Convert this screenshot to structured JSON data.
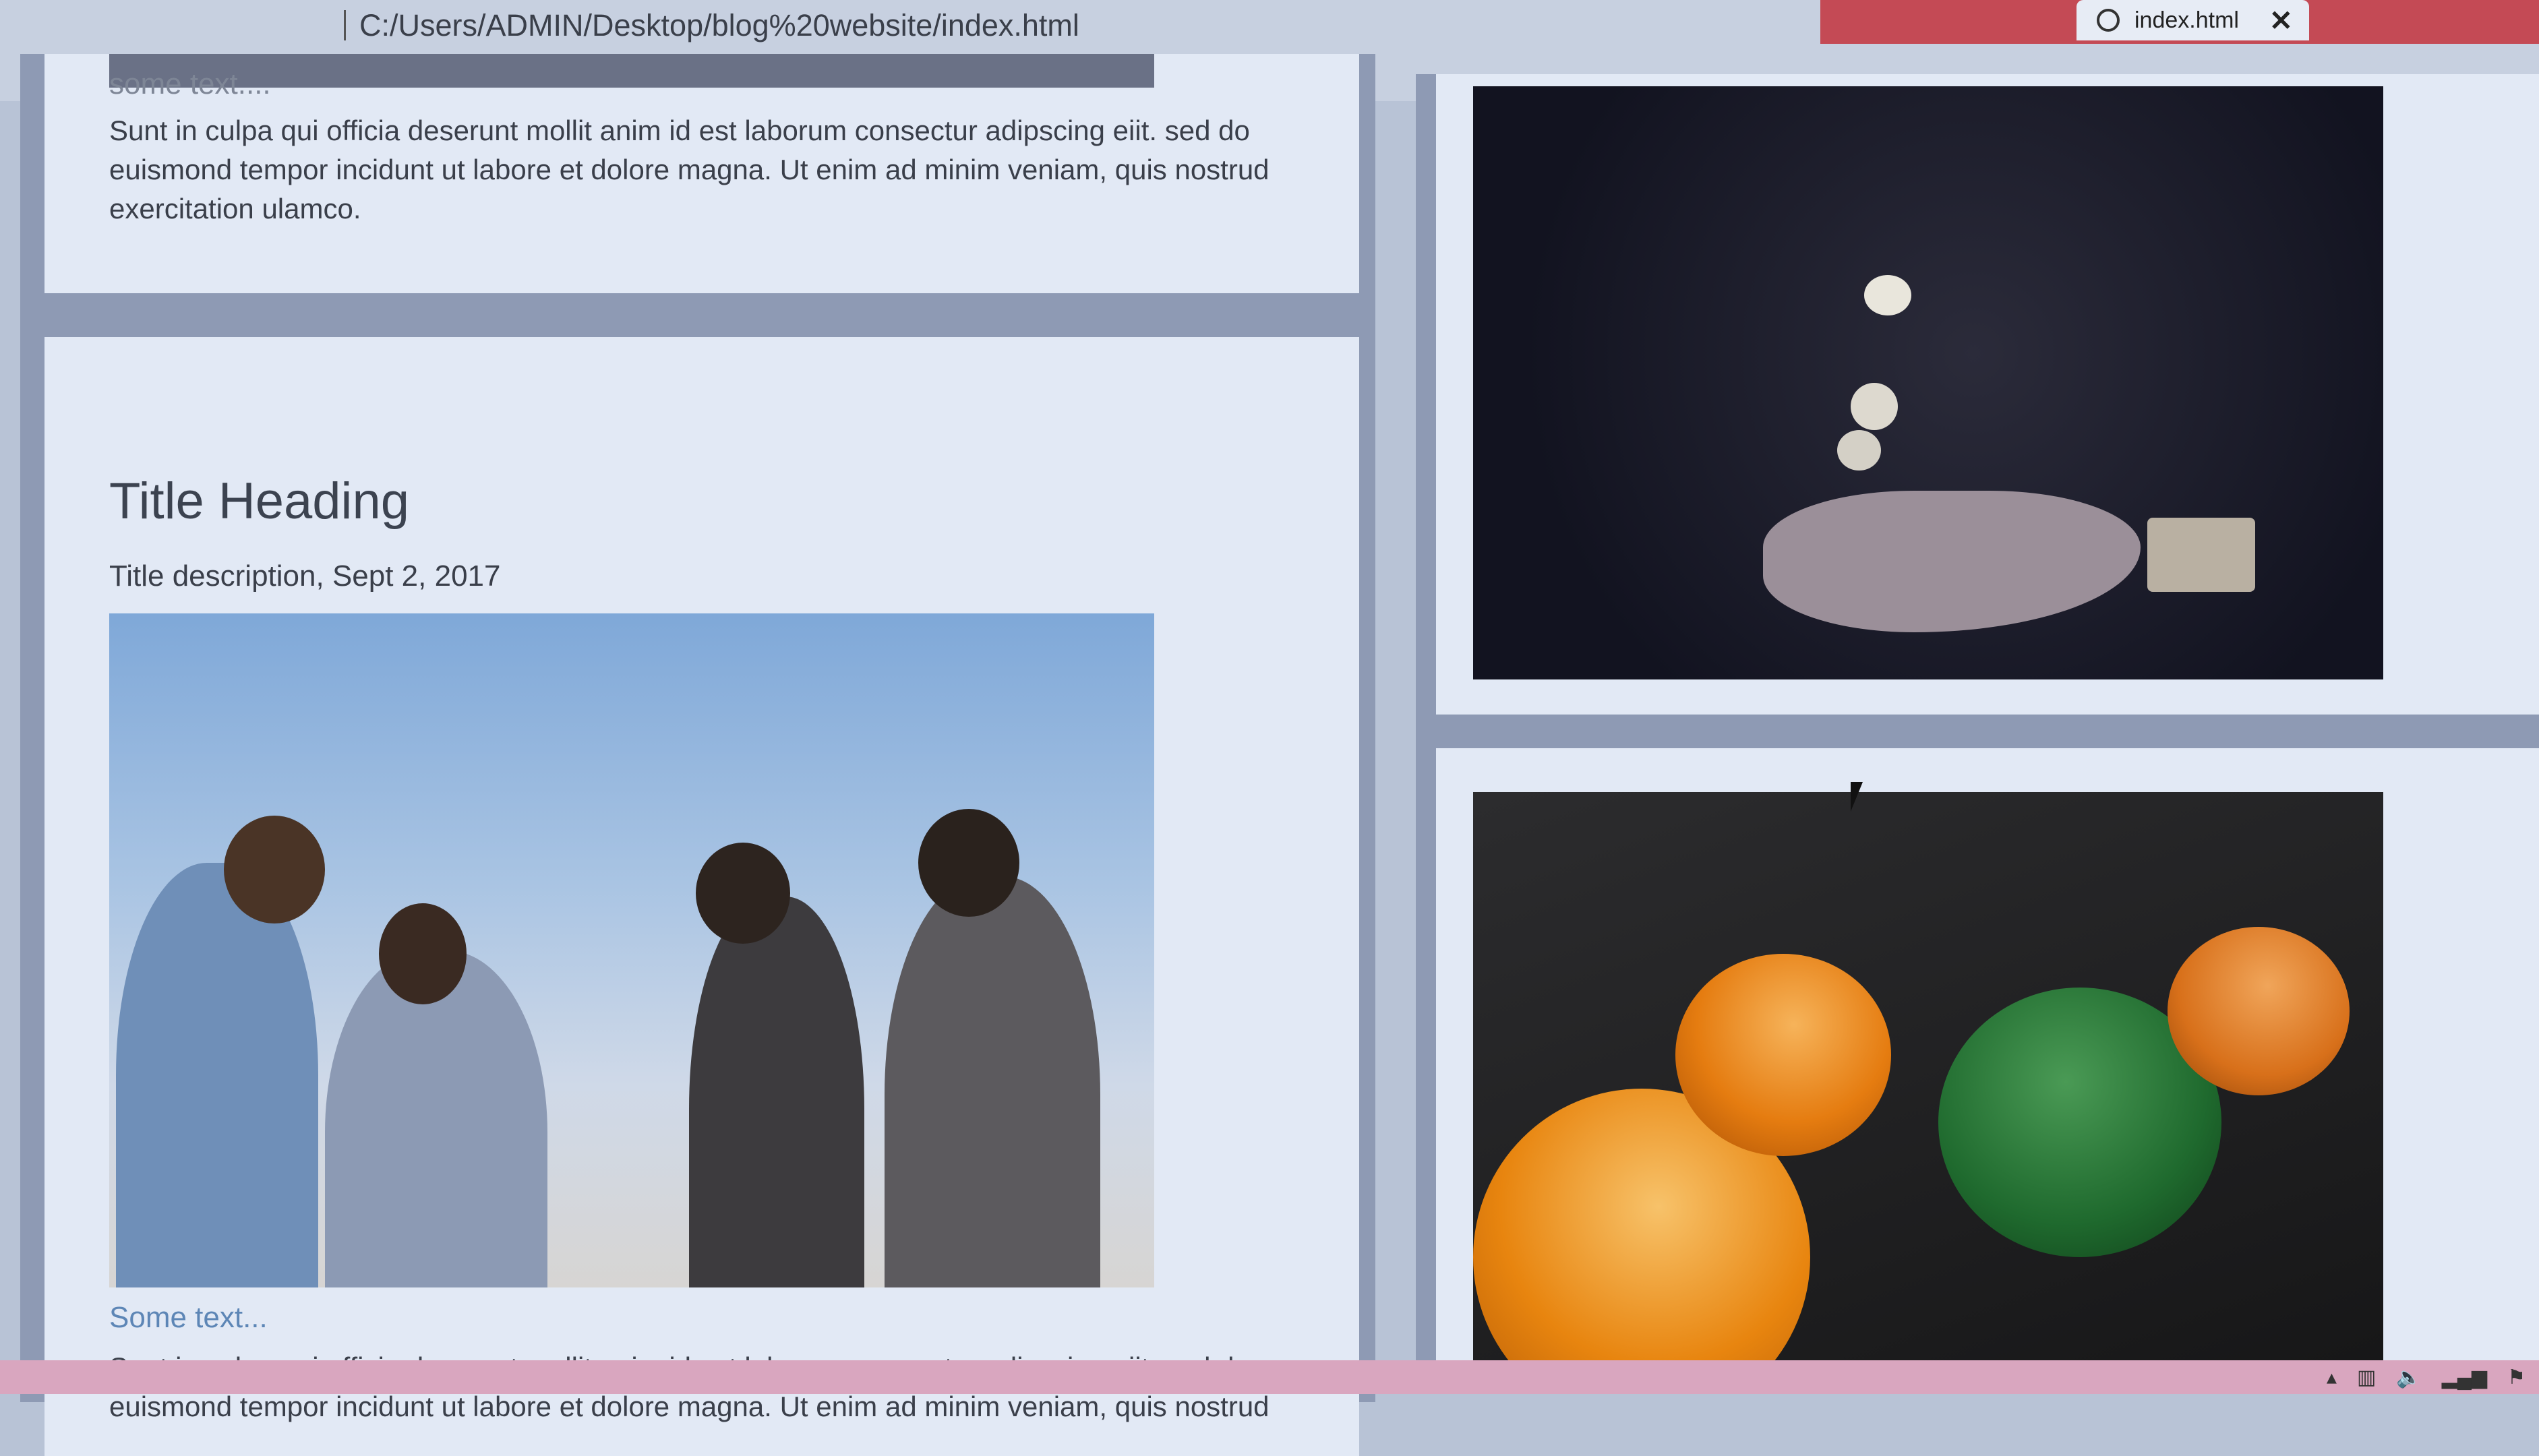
{
  "browser": {
    "address_url": "C:/Users/ADMIN/Desktop/blog%20website/index.html",
    "active_tab_title": "index.html",
    "tab_close_glyph": "✕",
    "toolbar_icons": [
      "star-icon",
      "account-icon",
      "extensions-icon"
    ],
    "colors": {
      "tab_strip": "#c44a55",
      "active_tab": "#e7ecf5"
    }
  },
  "left_column": {
    "card1": {
      "some_text": "some text....",
      "paragraph": "Sunt in culpa qui officia deserunt mollit anim id est laborum consectur adipscing eiit. sed do euismond tempor incidunt ut labore et dolore magna. Ut enim ad minim veniam, quis nostrud exercitation ulamco."
    },
    "card2": {
      "title": "Title Heading",
      "description": "Title description, Sept 2, 2017",
      "photo_alt": "group-of-friends-photo",
      "some_text": "Some text...",
      "paragraph": "Sunt in culpa qui officia deserunt mollit anim id est laborum consectur adipscing eiit. sed do euismond tempor incidunt ut labore et dolore magna. Ut enim ad minim veniam, quis nostrud"
    }
  },
  "right_column": {
    "card3": {
      "photo_alt": "hand-throwing-dice-photo"
    },
    "card4": {
      "photo_alt": "oranges-photo"
    }
  },
  "colors": {
    "page_background": "#8e9ab4",
    "card_background": "#e2e9f5",
    "text": "#3a3f4a",
    "muted_text": "#7e8696"
  }
}
